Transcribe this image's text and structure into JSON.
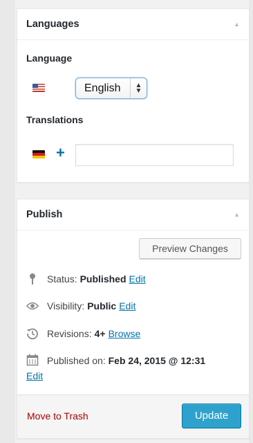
{
  "languages_box": {
    "title": "Languages",
    "language_label": "Language",
    "language_select": {
      "selected": "English",
      "arrows": "▲▼"
    },
    "language_flag": "flag-us-icon",
    "translations_label": "Translations",
    "translation_flag": "flag-de-icon",
    "add_translation_icon": "+",
    "translation_input": {
      "value": "",
      "placeholder": ""
    }
  },
  "publish_box": {
    "title": "Publish",
    "preview_button": "Preview Changes",
    "status": {
      "label": "Status:",
      "value": "Published",
      "action": "Edit"
    },
    "visibility": {
      "label": "Visibility:",
      "value": "Public",
      "action": "Edit"
    },
    "revisions": {
      "label": "Revisions:",
      "value": "4+",
      "action": "Browse"
    },
    "published_on": {
      "label": "Published on:",
      "value": "Feb 24, 2015 @ 12:31",
      "action": "Edit"
    },
    "trash_link": "Move to Trash",
    "update_button": "Update"
  },
  "colors": {
    "link": "#0073aa",
    "primary_button": "#2ea2cc",
    "trash": "#aa0000"
  }
}
